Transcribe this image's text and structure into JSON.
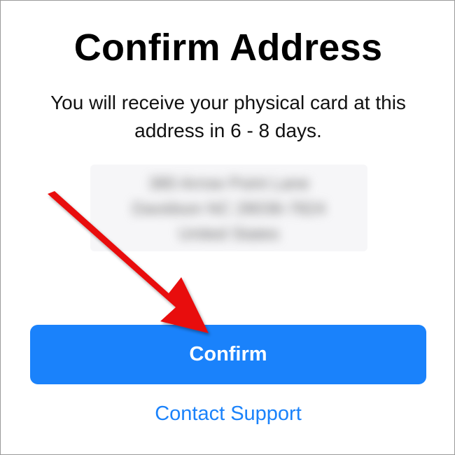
{
  "screen": {
    "title": "Confirm Address",
    "subtitle": "You will receive your physical card at this address in 6 - 8 days."
  },
  "address": {
    "lines": [
      "380 Arrow Point Lane",
      "Davidson NC 28036-7824",
      "United States"
    ],
    "blurred": true
  },
  "actions": {
    "confirm_label": "Confirm",
    "support_label": "Contact Support"
  },
  "annotation": {
    "icon": "arrow-pointer-icon",
    "color": "#e8110f"
  },
  "colors": {
    "accent": "#1a82fb",
    "background": "#ffffff",
    "text": "#000000"
  }
}
